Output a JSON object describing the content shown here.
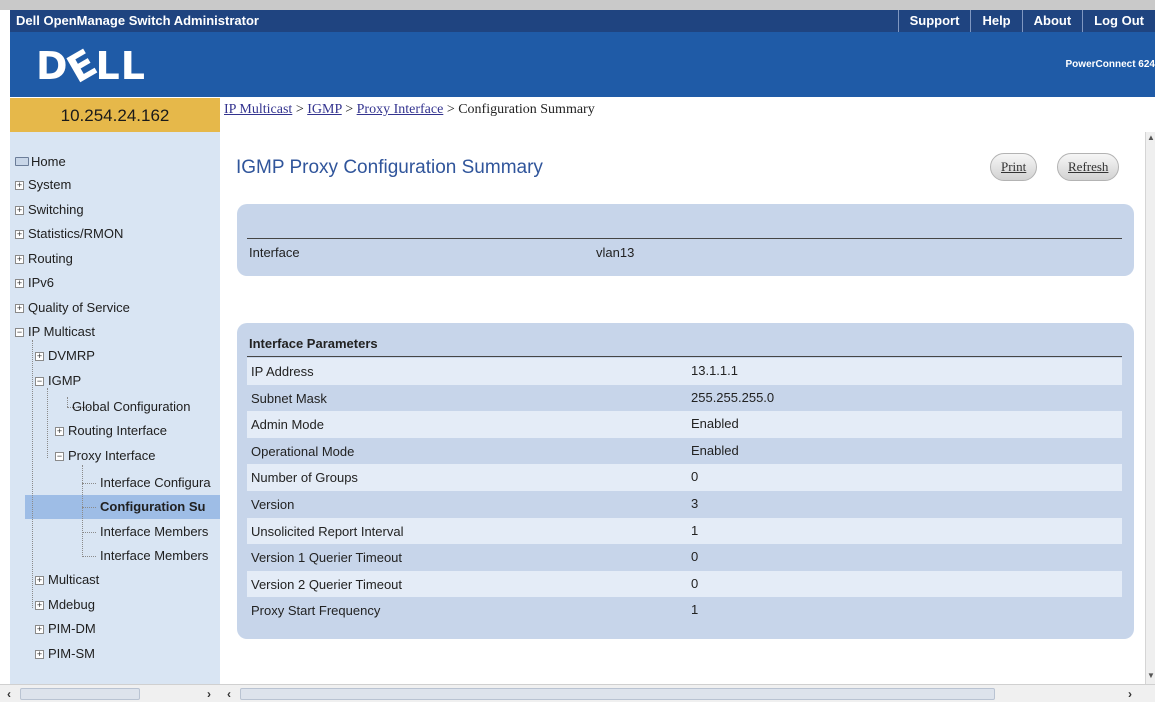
{
  "app": {
    "title": "Dell OpenManage Switch Administrator",
    "nav": [
      "Support",
      "Help",
      "About",
      "Log Out"
    ],
    "logo": "DELL",
    "product": "PowerConnect 624"
  },
  "sidebar": {
    "ip": "10.254.24.162",
    "items": {
      "home": "Home",
      "system": "System",
      "switching": "Switching",
      "statistics": "Statistics/RMON",
      "routing": "Routing",
      "ipv6": "IPv6",
      "qos": "Quality of Service",
      "ip_multicast": "IP Multicast",
      "dvmrp": "DVMRP",
      "igmp": "IGMP",
      "global_config": "Global Configuration",
      "routing_interface": "Routing Interface",
      "proxy_interface": "Proxy Interface",
      "interface_configuration": "Interface Configura",
      "configuration_summary": "Configuration Su",
      "interface_members_1": "Interface Members",
      "interface_members_2": "Interface Members",
      "multicast": "Multicast",
      "mdebug": "Mdebug",
      "pim_dm": "PIM-DM",
      "pim_sm": "PIM-SM"
    }
  },
  "breadcrumb": {
    "ip_multicast": "IP Multicast",
    "igmp": "IGMP",
    "proxy_interface": "Proxy Interface",
    "current": "Configuration Summary",
    "separator": ">"
  },
  "page": {
    "title": "IGMP Proxy Configuration Summary",
    "print_label": "Print",
    "refresh_label": "Refresh"
  },
  "interface_panel": {
    "label": "Interface",
    "value": "vlan13"
  },
  "params_panel": {
    "heading": "Interface Parameters",
    "rows": [
      {
        "label": "IP Address",
        "value": "13.1.1.1"
      },
      {
        "label": "Subnet Mask",
        "value": "255.255.255.0"
      },
      {
        "label": "Admin Mode",
        "value": "Enabled"
      },
      {
        "label": "Operational Mode",
        "value": "Enabled"
      },
      {
        "label": "Number of Groups",
        "value": "0"
      },
      {
        "label": "Version",
        "value": "3"
      },
      {
        "label": "Unsolicited Report Interval",
        "value": "1"
      },
      {
        "label": "Version 1 Querier Timeout",
        "value": "0"
      },
      {
        "label": "Version 2 Querier Timeout",
        "value": "0"
      },
      {
        "label": "Proxy Start Frequency",
        "value": "1"
      }
    ]
  }
}
